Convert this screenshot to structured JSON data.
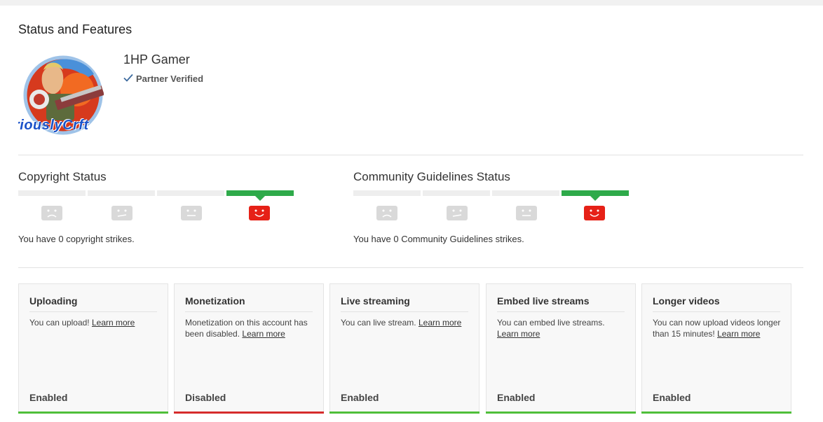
{
  "page": {
    "title": "Status and Features"
  },
  "channel": {
    "name": "1HP Gamer",
    "verified_label": "Partner Verified",
    "avatar_text": "riouslyCrft"
  },
  "copyright": {
    "title": "Copyright Status",
    "strikes_text": "You have 0 copyright strikes.",
    "active_level": 4
  },
  "community": {
    "title": "Community Guidelines Status",
    "strikes_text": "You have 0 Community Guidelines strikes.",
    "active_level": 4
  },
  "colors": {
    "enabled": "#4fbf3a",
    "disabled": "#d62c2c",
    "active_face": "#e62117",
    "inactive_face": "#d9d9d9",
    "progress_active": "#2eaa4a"
  },
  "features": [
    {
      "title": "Uploading",
      "desc": "You can upload!",
      "link": "Learn more",
      "status": "Enabled",
      "state": "enabled"
    },
    {
      "title": "Monetization",
      "desc": "Monetization on this account has been disabled.",
      "link": "Learn more",
      "status": "Disabled",
      "state": "disabled"
    },
    {
      "title": "Live streaming",
      "desc": "You can live stream.",
      "link": "Learn more",
      "status": "Enabled",
      "state": "enabled"
    },
    {
      "title": "Embed live streams",
      "desc": "You can embed live streams.",
      "link": "Learn more",
      "status": "Enabled",
      "state": "enabled"
    },
    {
      "title": "Longer videos",
      "desc": "You can now upload videos longer than 15 minutes!",
      "link": "Learn more",
      "status": "Enabled",
      "state": "enabled"
    }
  ]
}
